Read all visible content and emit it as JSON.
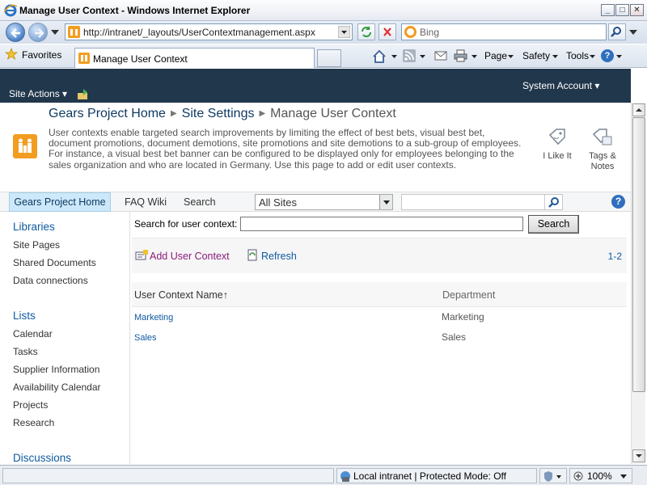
{
  "browser": {
    "window_title": "Manage User Context - Windows Internet Explorer",
    "address": "http://intranet/_layouts/UserContextmanagement.aspx",
    "search_placeholder": "Bing",
    "favorites_label": "Favorites",
    "tab_title": "Manage User Context",
    "commands": {
      "page": "Page",
      "safety": "Safety",
      "tools": "Tools"
    },
    "status": {
      "zone": "Local intranet | Protected Mode: Off",
      "zoom": "100%"
    }
  },
  "ribbon": {
    "site_actions": "Site Actions",
    "account": "System Account"
  },
  "titlearea": {
    "breadcrumb": [
      "Gears Project Home",
      "Site Settings",
      "Manage User Context"
    ],
    "description": "User contexts enable targeted search improvements by limiting the effect of best bets, visual best bet, document promotions, document demotions, site promotions and site demotions to a sub-group of employees. For instance, a visual best bet banner can be configured to be displayed only for employees belonging to the sales organization and who are located in Germany. Use this page to add or edit user contexts.",
    "like_label": "I Like It",
    "tags_label_1": "Tags &",
    "tags_label_2": "Notes"
  },
  "topnav": {
    "home": "Gears Project Home",
    "items": [
      "FAQ Wiki",
      "Search"
    ],
    "scope": "All Sites"
  },
  "quicklaunch": {
    "libraries_header": "Libraries",
    "libraries": [
      "Site Pages",
      "Shared Documents",
      "Data connections"
    ],
    "lists_header": "Lists",
    "lists": [
      "Calendar",
      "Tasks",
      "Supplier Information",
      "Availability Calendar",
      "Projects",
      "Research"
    ],
    "discussions_header": "Discussions"
  },
  "main": {
    "search_label": "Search for user context:",
    "search_value": "",
    "search_button": "Search",
    "add_label": "Add User Context",
    "refresh_label": "Refresh",
    "paging": "1-2",
    "columns": [
      "User Context Name",
      "Department"
    ],
    "sort_indicator": "↑",
    "rows": [
      {
        "name": "Marketing",
        "department": "Marketing"
      },
      {
        "name": "Sales",
        "department": "Sales"
      }
    ]
  },
  "colors": {
    "ribbon": "#21374c",
    "link": "#0f5aa0",
    "accent": "#f29d20"
  }
}
